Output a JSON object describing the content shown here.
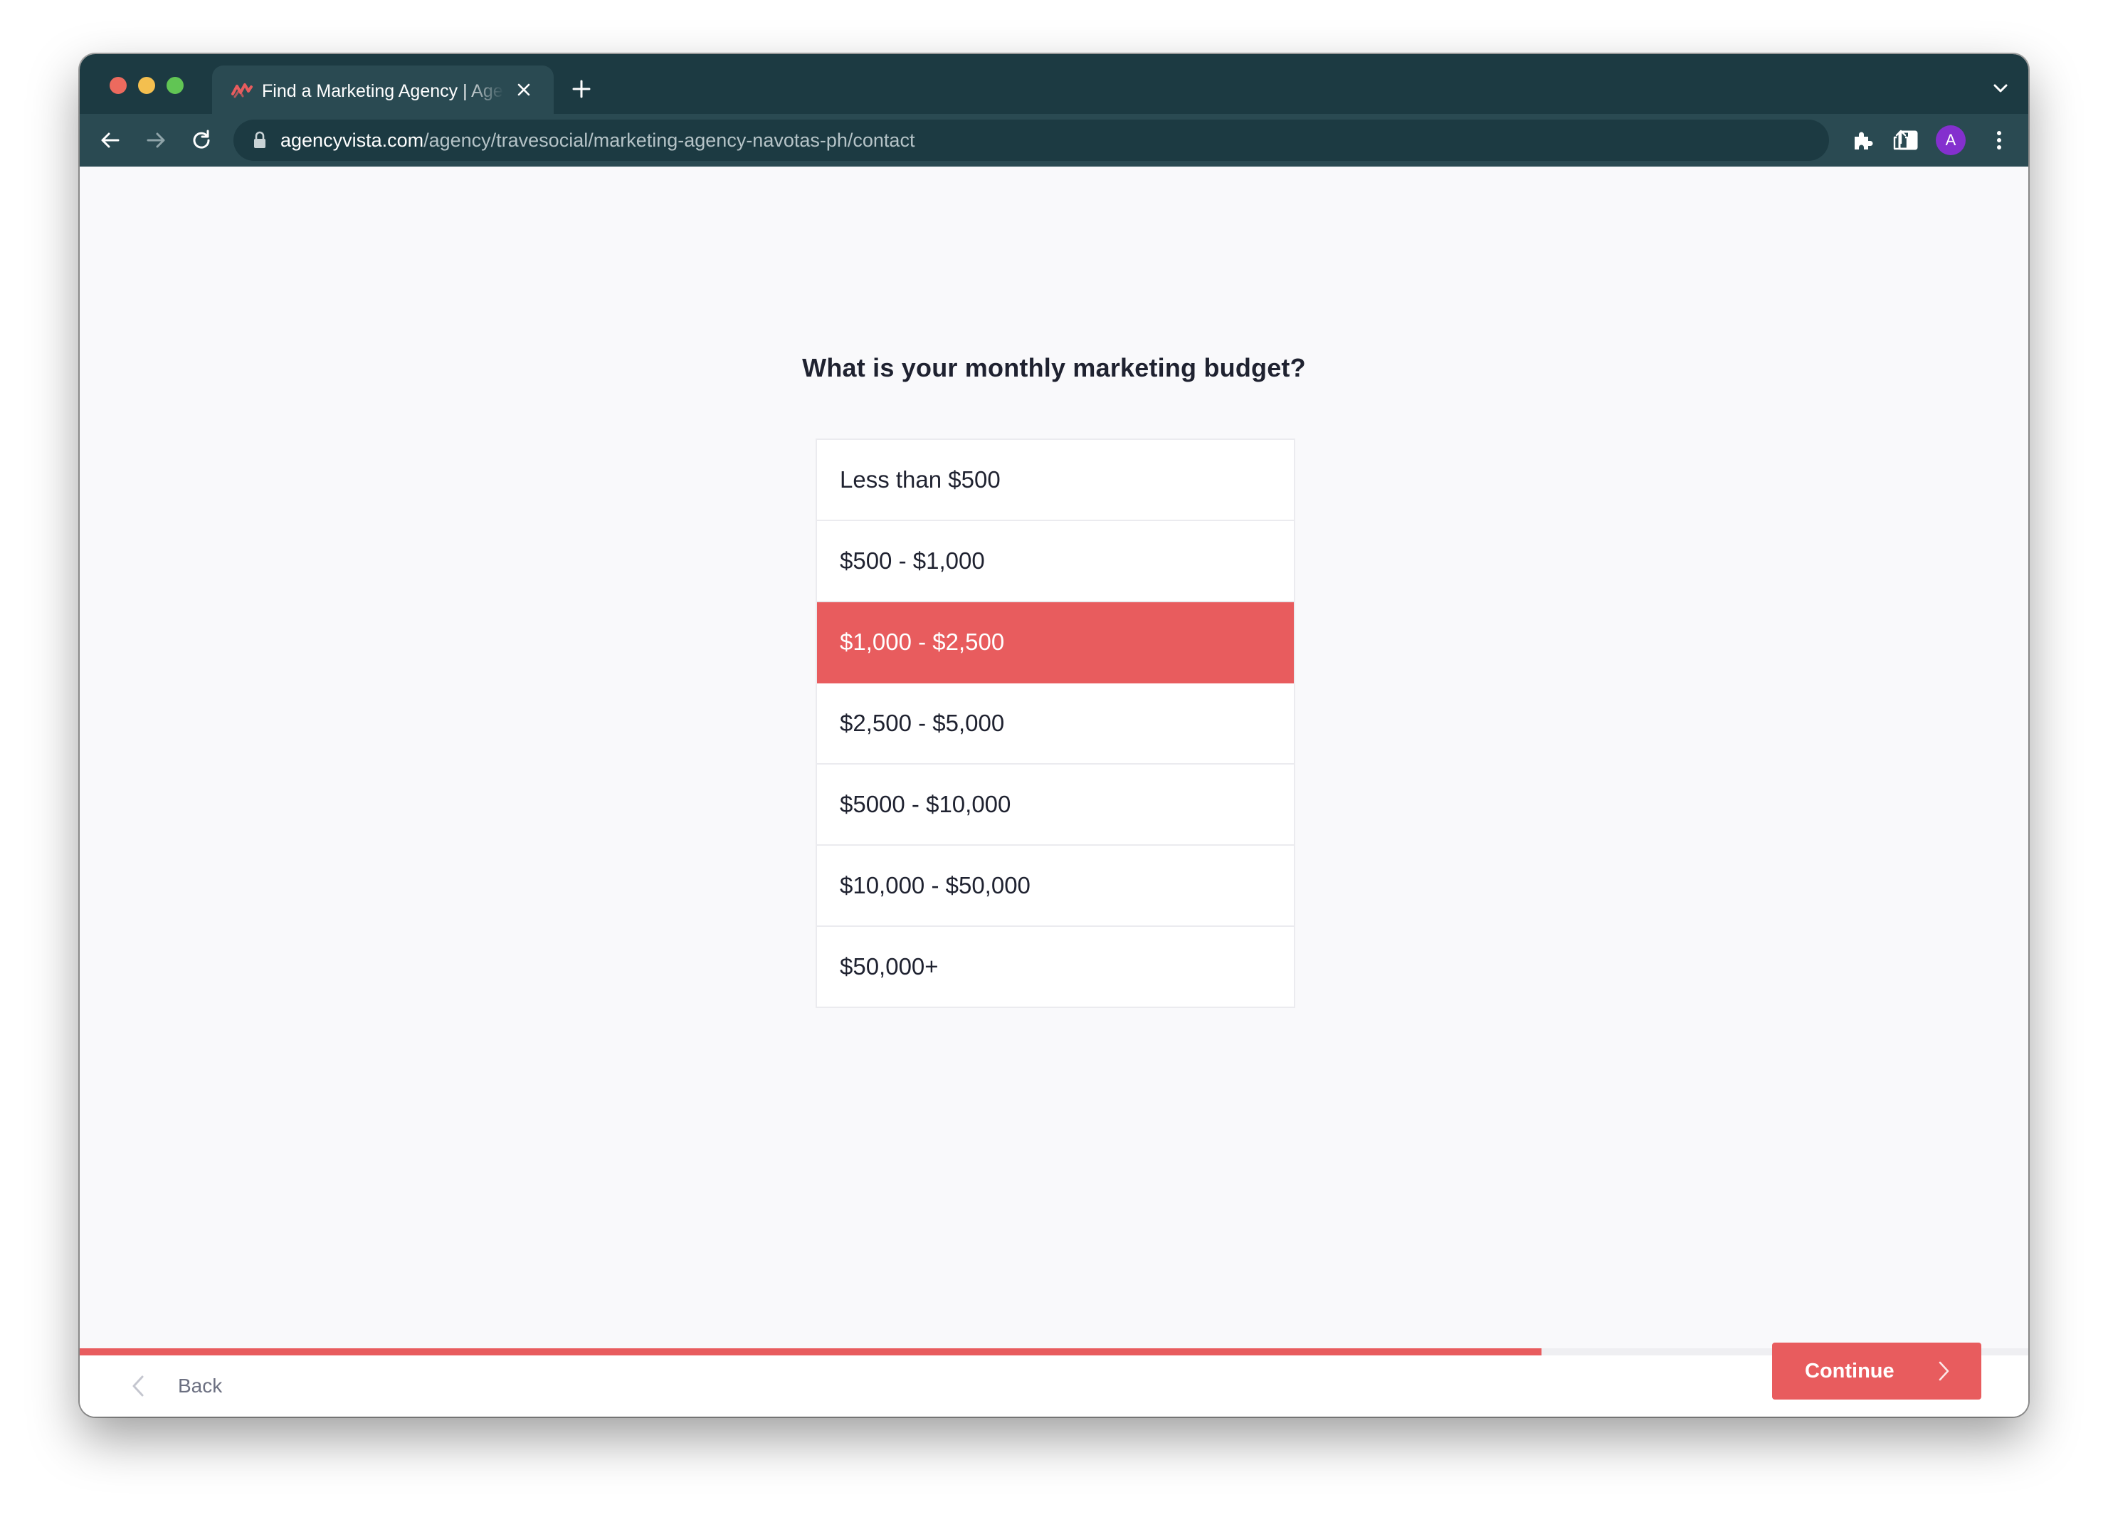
{
  "browser": {
    "tab_title": "Find a Marketing Agency | Agency Vista",
    "url_host": "agencyvista.com",
    "url_path": "/agency/travesocial/marketing-agency-navotas-ph/contact",
    "profile_initial": "A"
  },
  "form": {
    "question": "What is your monthly marketing budget?",
    "options": [
      {
        "label": "Less than $500",
        "selected": false
      },
      {
        "label": "$500 - $1,000",
        "selected": false
      },
      {
        "label": "$1,000 - $2,500",
        "selected": true
      },
      {
        "label": "$2,500 - $5,000",
        "selected": false
      },
      {
        "label": "$5000 - $10,000",
        "selected": false
      },
      {
        "label": "$10,000 - $50,000",
        "selected": false
      },
      {
        "label": "$50,000+",
        "selected": false
      }
    ],
    "progress_percent": 75
  },
  "footer": {
    "back_label": "Back",
    "continue_label": "Continue"
  },
  "colors": {
    "accent": "#e85c5e",
    "browser_frame": "#1c3a42"
  },
  "icons": {
    "tab_favicon": "agency-vista-logo-icon",
    "back_nav": "arrow-left-icon",
    "forward_nav": "arrow-right-icon",
    "reload": "reload-icon",
    "lock": "lock-icon",
    "share": "share-icon",
    "bookmark": "star-icon",
    "extensions": "puzzle-icon",
    "side_panel": "side-panel-icon",
    "menu": "kebab-menu-icon",
    "footer_back": "chevron-left-icon",
    "continue": "chevron-right-icon"
  }
}
